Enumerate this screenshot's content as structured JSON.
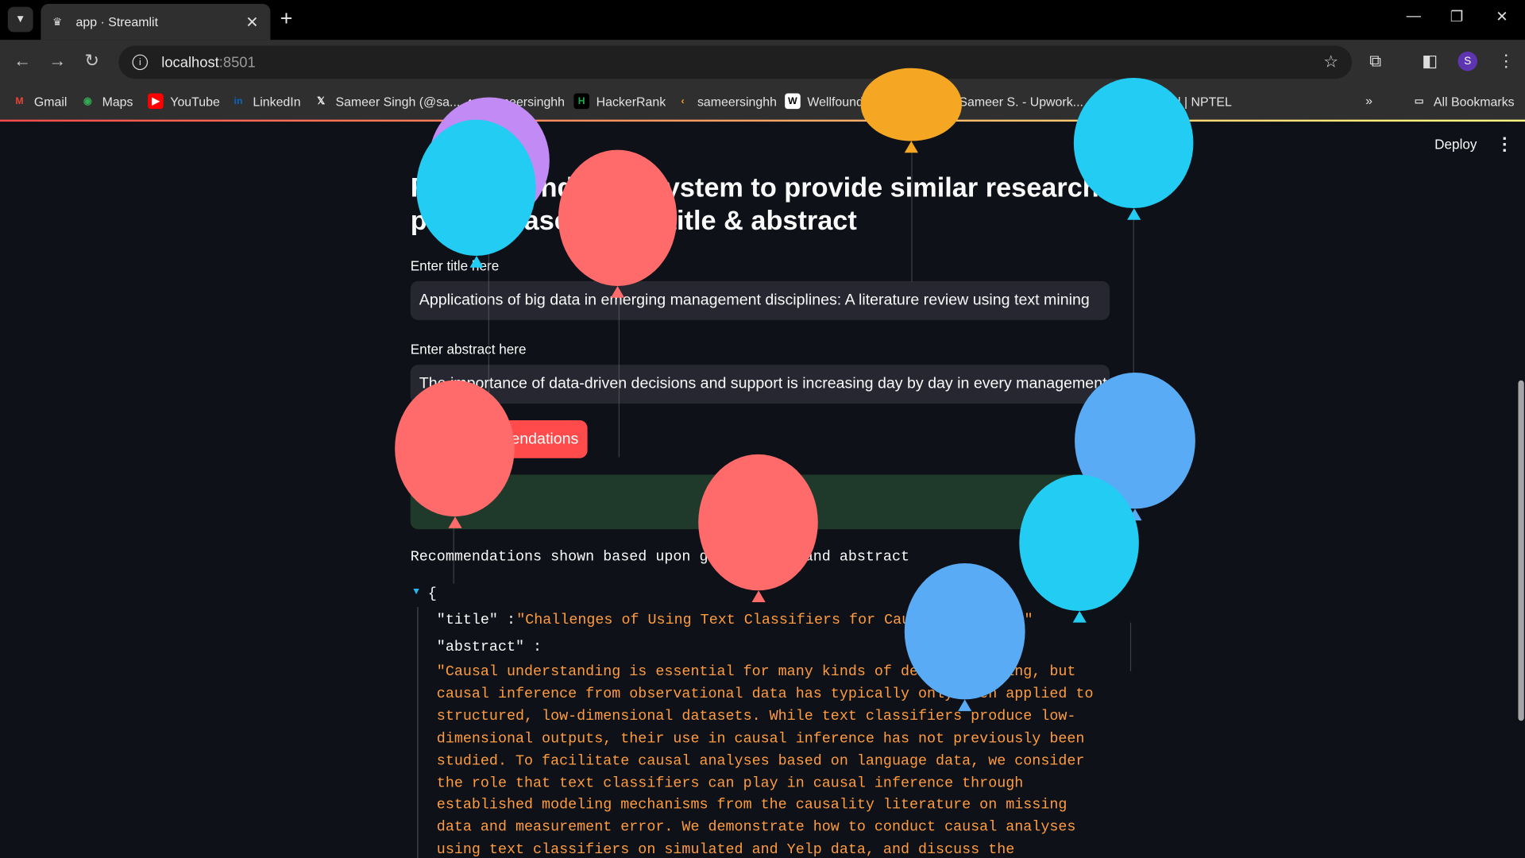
{
  "browser": {
    "tab_title": "app · Streamlit",
    "url_host": "localhost",
    "url_port": ":8501",
    "bookmarks": [
      {
        "label": "Gmail",
        "icon": "gmail-icon",
        "color": "#ea4335"
      },
      {
        "label": "Maps",
        "icon": "maps-icon",
        "color": "#34a853"
      },
      {
        "label": "YouTube",
        "icon": "youtube-icon",
        "color": "#ff0000"
      },
      {
        "label": "LinkedIn",
        "icon": "linkedin-icon",
        "color": "#0a66c2"
      },
      {
        "label": "Sameer Singh (@sa...",
        "icon": "x-icon",
        "color": "#000000"
      },
      {
        "label": "sameersinghh",
        "icon": "github-icon",
        "color": "#ffffff"
      },
      {
        "label": "HackerRank",
        "icon": "hackerrank-icon",
        "color": "#1ba94c"
      },
      {
        "label": "sameersinghh",
        "icon": "leetcode-icon",
        "color": "#ffa116"
      },
      {
        "label": "Wellfound (formerly...",
        "icon": "wellfound-icon",
        "color": "#ffffff"
      },
      {
        "label": "Sameer S. - Upwork...",
        "icon": "upwork-icon",
        "color": "#14a800"
      },
      {
        "label": "GATE Portal | NPTEL",
        "icon": "nptel-icon",
        "color": "#b71c1c"
      }
    ],
    "all_bookmarks": "All Bookmarks",
    "avatar_letter": "S"
  },
  "app": {
    "deploy_label": "Deploy",
    "title_line1": "Recommendation System to provide similar research",
    "title_line2": "papers based upon title & abstract",
    "title_label": "Enter title here",
    "title_value": "Applications of big data in emerging management disciplines: A literature review using text mining",
    "abstract_label": "Enter abstract here",
    "abstract_value": "The importance of data-driven decisions and support is increasing day by day in every management area",
    "button_label": "Get Recommendations",
    "caption": "Recommendations shown based upon given title and abstract",
    "json_title_key": "\"title\" :",
    "json_title_value": "\"Challenges of Using Text Classifiers for Causal Inference\"",
    "json_abstract_key": "\"abstract\" :",
    "json_abstract_value": "\"Causal understanding is essential for many kinds of decision-making, but causal inference from observational data has typically only been applied to structured, low-dimensional datasets. While text classifiers produce low-dimensional outputs, their use in causal inference has not previously been studied. To facilitate causal analyses based on language data, we consider the role that text classifiers can play in causal inference through established modeling mechanisms from the causality literature on missing data and measurement error. We demonstrate how to conduct causal analyses using text classifiers on simulated and Yelp data, and discuss the opportunities and"
  },
  "colors": {
    "accent": "#ff4b4b",
    "json_string": "#ff9c40",
    "balloon_red": "#ff6b6b",
    "balloon_cyan": "#22ccf2",
    "balloon_blue": "#5aabf5",
    "balloon_purple": "#c28af5",
    "balloon_orange": "#f5a623"
  }
}
